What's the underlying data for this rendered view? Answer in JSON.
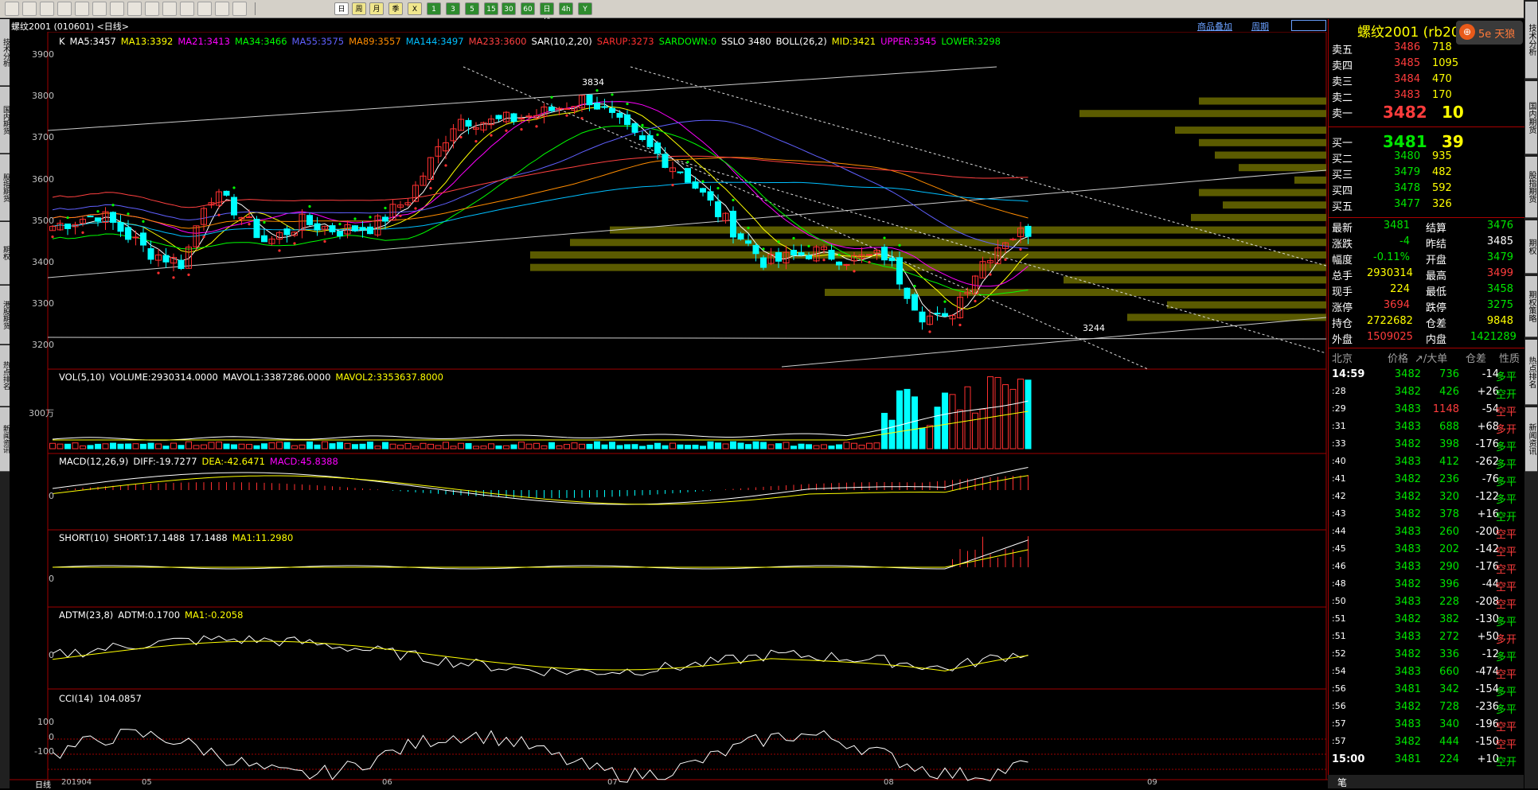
{
  "toolbar": {
    "periods": [
      "日",
      "周",
      "月",
      "季",
      "X",
      "1",
      "3",
      "5",
      "15",
      "30",
      "60",
      "日线",
      "4h",
      "Y"
    ]
  },
  "window": {
    "title": "螺纹2001 (010601) <日线>",
    "links": [
      "商品叠加",
      "周期"
    ]
  },
  "left_tabs": [
    "技术分析",
    "国内期货",
    "股指期货",
    "期权",
    "港股期货",
    "热点排名",
    "新闻资讯"
  ],
  "right_tabs": [
    "技术分析",
    "国内期货",
    "股指期货",
    "期权",
    "期权策略",
    "热点排名",
    "新闻资讯"
  ],
  "indicators": {
    "ma": [
      {
        "t": "K",
        "c": "#ffffff"
      },
      {
        "t": "MA5:3457",
        "c": "#ffffff"
      },
      {
        "t": "MA13:3392",
        "c": "#ffff00"
      },
      {
        "t": "MA21:3413",
        "c": "#ff00ff"
      },
      {
        "t": "MA34:3466",
        "c": "#00ff00"
      },
      {
        "t": "MA55:3575",
        "c": "#6060ff"
      },
      {
        "t": "MA89:3557",
        "c": "#ff8c00"
      },
      {
        "t": "MA144:3497",
        "c": "#00bfff"
      },
      {
        "t": "MA233:3600",
        "c": "#ff4040"
      },
      {
        "t": "SAR(10,2,20)",
        "c": "#ffffff"
      },
      {
        "t": "SARUP:3273",
        "c": "#ff3030"
      },
      {
        "t": "SARDOWN:0",
        "c": "#00ff00"
      },
      {
        "t": "SSLO 3480",
        "c": "#ffffff"
      },
      {
        "t": "BOLL(26,2)",
        "c": "#ffffff"
      },
      {
        "t": "MID:3421",
        "c": "#ffff00"
      },
      {
        "t": "UPPER:3545",
        "c": "#ff00ff"
      },
      {
        "t": "LOWER:3298",
        "c": "#00ff00"
      }
    ],
    "vol": [
      {
        "t": "VOL(5,10)",
        "c": "#ffffff"
      },
      {
        "t": "VOLUME:2930314.0000",
        "c": "#ffffff"
      },
      {
        "t": "MAVOL1:3387286.0000",
        "c": "#ffffff"
      },
      {
        "t": "MAVOL2:3353637.8000",
        "c": "#ffff00"
      }
    ],
    "macd": [
      {
        "t": "MACD(12,26,9)",
        "c": "#ffffff"
      },
      {
        "t": "DIFF:-19.7277",
        "c": "#ffffff"
      },
      {
        "t": "DEA:-42.6471",
        "c": "#ffff00"
      },
      {
        "t": "MACD:45.8388",
        "c": "#ff00ff"
      }
    ],
    "short": [
      {
        "t": "SHORT(10)",
        "c": "#ffffff"
      },
      {
        "t": "SHORT:17.1488",
        "c": "#ffffff"
      },
      {
        "t": "17.1488",
        "c": "#ffffff"
      },
      {
        "t": "MA1:11.2980",
        "c": "#ffff00"
      }
    ],
    "adtm": [
      {
        "t": "ADTM(23,8)",
        "c": "#ffffff"
      },
      {
        "t": "ADTM:0.1700",
        "c": "#ffffff"
      },
      {
        "t": "MA1:-0.2058",
        "c": "#ffff00"
      }
    ],
    "cci": [
      {
        "t": "CCI(14)",
        "c": "#ffffff"
      },
      {
        "t": "104.0857",
        "c": "#ffffff"
      }
    ]
  },
  "axis": {
    "price": [
      "3900",
      "3800",
      "3700",
      "3600",
      "3500",
      "3400",
      "3300",
      "3200"
    ],
    "vol": "300万",
    "zero": "0",
    "cci": [
      "100",
      "0",
      "-100"
    ],
    "x_label": "日线",
    "x": [
      "201904",
      "05",
      "06",
      "07",
      "08",
      "09"
    ],
    "peak": "3834",
    "trough": "3244"
  },
  "panel": {
    "title": "螺纹2001 (rb2001)",
    "logo": "5e 天狼",
    "asks": [
      {
        "l": "卖五",
        "p": "3486",
        "v": "718"
      },
      {
        "l": "卖四",
        "p": "3485",
        "v": "1095"
      },
      {
        "l": "卖三",
        "p": "3484",
        "v": "470"
      },
      {
        "l": "卖二",
        "p": "3483",
        "v": "170"
      },
      {
        "l": "卖一",
        "p": "3482",
        "v": "10"
      }
    ],
    "bids": [
      {
        "l": "买一",
        "p": "3481",
        "v": "39"
      },
      {
        "l": "买二",
        "p": "3480",
        "v": "935"
      },
      {
        "l": "买三",
        "p": "3479",
        "v": "482"
      },
      {
        "l": "买四",
        "p": "3478",
        "v": "592"
      },
      {
        "l": "买五",
        "p": "3477",
        "v": "326"
      }
    ],
    "stats": [
      {
        "a": "最新",
        "av": "3481",
        "b": "结算",
        "bv": "3476",
        "ac": "grn",
        "bc": "grn"
      },
      {
        "a": "涨跌",
        "av": "-4",
        "b": "昨结",
        "bv": "3485",
        "ac": "grn",
        "bc": "wht"
      },
      {
        "a": "幅度",
        "av": "-0.11%",
        "b": "开盘",
        "bv": "3479",
        "ac": "grn",
        "bc": "grn"
      },
      {
        "a": "总手",
        "av": "2930314",
        "b": "最高",
        "bv": "3499",
        "ac": "yel",
        "bc": "red"
      },
      {
        "a": "现手",
        "av": "224",
        "b": "最低",
        "bv": "3458",
        "ac": "yel",
        "bc": "grn"
      },
      {
        "a": "涨停",
        "av": "3694",
        "b": "跌停",
        "bv": "3275",
        "ac": "red",
        "bc": "grn"
      },
      {
        "a": "持仓",
        "av": "2722682",
        "b": "仓差",
        "bv": "9848",
        "ac": "yel",
        "bc": "yel"
      },
      {
        "a": "外盘",
        "av": "1509025",
        "b": "内盘",
        "bv": "1421289",
        "ac": "red",
        "bc": "grn"
      }
    ],
    "tick_header": [
      "北京",
      "价格",
      "↗/大单",
      "仓差",
      "性质"
    ],
    "ticks": [
      {
        "t": "14:59",
        "p": "3482",
        "v": "736",
        "d": "-14",
        "n": "多平",
        "nc": "grn"
      },
      {
        "t": ":28",
        "p": "3482",
        "v": "426",
        "d": "+26",
        "n": "空开",
        "nc": "grn"
      },
      {
        "t": ":29",
        "p": "3483",
        "v": "1148",
        "d": "-54",
        "n": "空平",
        "nc": "red"
      },
      {
        "t": ":31",
        "p": "3483",
        "v": "688",
        "d": "+68",
        "n": "多开",
        "nc": "red"
      },
      {
        "t": ":33",
        "p": "3482",
        "v": "398",
        "d": "-176",
        "n": "多平",
        "nc": "grn"
      },
      {
        "t": ":40",
        "p": "3483",
        "v": "412",
        "d": "-262",
        "n": "多平",
        "nc": "grn"
      },
      {
        "t": ":41",
        "p": "3482",
        "v": "236",
        "d": "-76",
        "n": "多平",
        "nc": "grn"
      },
      {
        "t": ":42",
        "p": "3482",
        "v": "320",
        "d": "-122",
        "n": "多平",
        "nc": "grn"
      },
      {
        "t": ":43",
        "p": "3482",
        "v": "378",
        "d": "+16",
        "n": "空开",
        "nc": "grn"
      },
      {
        "t": ":44",
        "p": "3483",
        "v": "260",
        "d": "-200",
        "n": "空平",
        "nc": "red"
      },
      {
        "t": ":45",
        "p": "3483",
        "v": "202",
        "d": "-142",
        "n": "空平",
        "nc": "red"
      },
      {
        "t": ":46",
        "p": "3483",
        "v": "290",
        "d": "-176",
        "n": "空平",
        "nc": "red"
      },
      {
        "t": ":48",
        "p": "3482",
        "v": "396",
        "d": "-44",
        "n": "空平",
        "nc": "red"
      },
      {
        "t": ":50",
        "p": "3483",
        "v": "228",
        "d": "-208",
        "n": "空平",
        "nc": "red"
      },
      {
        "t": ":51",
        "p": "3482",
        "v": "382",
        "d": "-130",
        "n": "多平",
        "nc": "grn"
      },
      {
        "t": ":51",
        "p": "3483",
        "v": "272",
        "d": "+50",
        "n": "多开",
        "nc": "red"
      },
      {
        "t": ":52",
        "p": "3482",
        "v": "336",
        "d": "-12",
        "n": "多平",
        "nc": "grn"
      },
      {
        "t": ":54",
        "p": "3483",
        "v": "660",
        "d": "-474",
        "n": "空平",
        "nc": "red"
      },
      {
        "t": ":56",
        "p": "3481",
        "v": "342",
        "d": "-154",
        "n": "多平",
        "nc": "grn"
      },
      {
        "t": ":56",
        "p": "3482",
        "v": "728",
        "d": "-236",
        "n": "多平",
        "nc": "grn"
      },
      {
        "t": ":57",
        "p": "3483",
        "v": "340",
        "d": "-196",
        "n": "空平",
        "nc": "red"
      },
      {
        "t": ":57",
        "p": "3482",
        "v": "444",
        "d": "-150",
        "n": "空平",
        "nc": "red"
      },
      {
        "t": "15:00",
        "p": "3481",
        "v": "224",
        "d": "+10",
        "n": "空开",
        "nc": "grn"
      }
    ],
    "bottom_tab": "笔"
  }
}
